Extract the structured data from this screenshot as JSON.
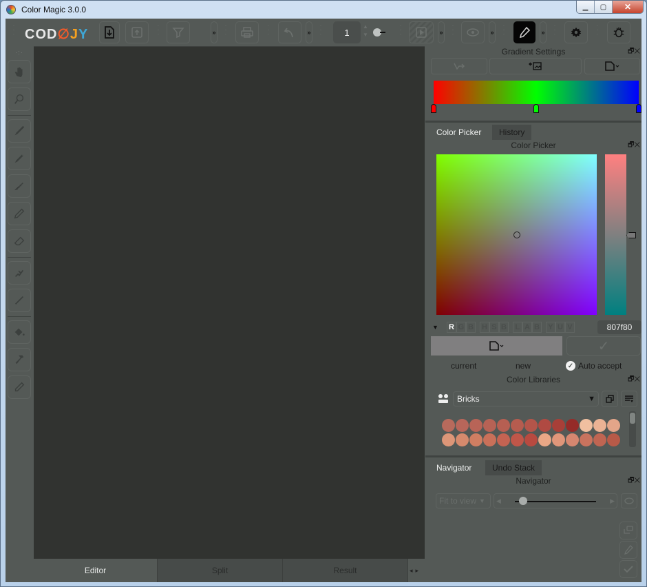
{
  "window": {
    "title": "Color Magic 3.0.0",
    "minimize_label": "▁",
    "maximize_label": "▢",
    "close_label": "✕"
  },
  "toolbar": {
    "logo_letters": [
      {
        "ch": "C",
        "color": "#e8e8e8"
      },
      {
        "ch": "O",
        "color": "#e8e8e8"
      },
      {
        "ch": "D",
        "color": "#e8e8e8"
      },
      {
        "ch": "∅",
        "color": "#f25a2a"
      },
      {
        "ch": "J",
        "color": "#f4a020"
      },
      {
        "ch": "Y",
        "color": "#3fa7d6"
      }
    ],
    "overflow_label": "»",
    "frame_value": "1",
    "spin_up": "▲",
    "spin_down": "▼"
  },
  "left_tools": {
    "move_grip": "·:·"
  },
  "bottom_tabs": [
    {
      "label": "Editor",
      "active": true
    },
    {
      "label": "Split",
      "active": false
    },
    {
      "label": "Result",
      "active": false
    }
  ],
  "bottom_scroll": {
    "left": "◂",
    "right": "▸"
  },
  "gradient_settings": {
    "title": "Gradient Settings",
    "dock_controls": "🗗✕",
    "stops": [
      {
        "color": "#ff0000",
        "position": 0
      },
      {
        "color": "#00ff00",
        "position": 0.5
      },
      {
        "color": "#0000ff",
        "position": 1
      }
    ]
  },
  "color_picker_tabs": [
    {
      "label": "Color Picker",
      "active": true
    },
    {
      "label": "History",
      "active": false
    }
  ],
  "color_picker": {
    "title": "Color Picker",
    "dock_controls": "🗗✕",
    "mode_arrow": "▼",
    "mode_groups": [
      [
        "R",
        "G",
        "B"
      ],
      [
        "H",
        "S",
        "B"
      ],
      [
        "L",
        "A",
        "B"
      ],
      [
        "Y",
        "U",
        "V"
      ]
    ],
    "active_mode": "R",
    "hex_value": "807f80",
    "current_color": "#807f80",
    "current_label": "current",
    "new_label": "new",
    "auto_accept_label": "Auto accept",
    "auto_accept_checked": true,
    "accept_icon": "✓"
  },
  "color_libraries": {
    "title": "Color Libraries",
    "dock_controls": "🗗✕",
    "selected_library": "Bricks",
    "swatches": [
      "#b86a5c",
      "#b8665a",
      "#b86457",
      "#b76255",
      "#b65f52",
      "#b55c4f",
      "#b4554a",
      "#b04a42",
      "#a83f38",
      "#952b28",
      "#f0bfa0",
      "#ebb294",
      "#e3a589",
      "#dd9678",
      "#d68a6d",
      "#cf7e62",
      "#c97059",
      "#c46352",
      "#c05649",
      "#b84a40",
      "#e9a786",
      "#e0967a",
      "#d68770",
      "#c9735e",
      "#c06552",
      "#b85a48"
    ]
  },
  "navigator_tabs": [
    {
      "label": "Navigator",
      "active": true
    },
    {
      "label": "Undo Stack",
      "active": false
    }
  ],
  "navigator": {
    "title": "Navigator",
    "dock_controls": "🗗✕",
    "zoom_mode": "Fit to view",
    "zoom_level": 0.1,
    "prev_label": "◀",
    "next_label": "▶"
  }
}
